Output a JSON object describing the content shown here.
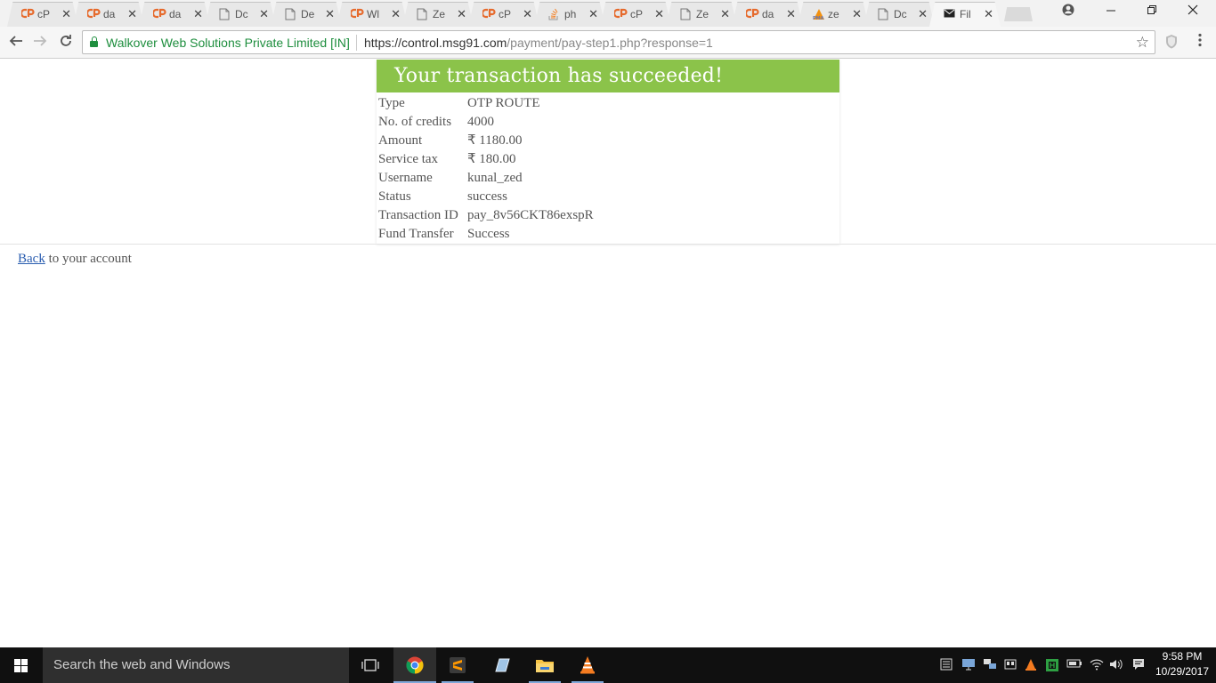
{
  "browser": {
    "tabs": [
      {
        "title": "cP",
        "icon": "cpanel-icon"
      },
      {
        "title": "da",
        "icon": "cpanel-icon"
      },
      {
        "title": "da",
        "icon": "cpanel-icon"
      },
      {
        "title": "Dc",
        "icon": "document-icon"
      },
      {
        "title": "De",
        "icon": "document-icon"
      },
      {
        "title": "Wl",
        "icon": "cpanel-icon"
      },
      {
        "title": "Ze",
        "icon": "document-icon"
      },
      {
        "title": "cP",
        "icon": "cpanel-icon"
      },
      {
        "title": "ph",
        "icon": "stackoverflow-icon"
      },
      {
        "title": "cP",
        "icon": "cpanel-icon"
      },
      {
        "title": "Ze",
        "icon": "document-icon"
      },
      {
        "title": "da",
        "icon": "cpanel-icon"
      },
      {
        "title": "ze",
        "icon": "phpmyadmin-icon"
      },
      {
        "title": "Dc",
        "icon": "document-icon"
      },
      {
        "title": "Fil",
        "icon": "mail-icon"
      }
    ],
    "close_glyph": "✕",
    "cert_name": "Walkover Web Solutions Private Limited [IN]",
    "url_host": "https://control.msg91.com",
    "url_path": "/payment/pay-step1.php?response=1"
  },
  "page": {
    "heading": "Your transaction has succeeded!",
    "rows": [
      {
        "label": "Type",
        "value": "OTP ROUTE"
      },
      {
        "label": "No. of credits",
        "value": "4000"
      },
      {
        "label": "Amount",
        "value": "₹ 1180.00"
      },
      {
        "label": "Service tax",
        "value": "₹ 180.00"
      },
      {
        "label": "Username",
        "value": "kunal_zed"
      },
      {
        "label": "Status",
        "value": "success"
      },
      {
        "label": "Transaction ID",
        "value": "pay_8v56CKT86exspR"
      },
      {
        "label": "Fund Transfer",
        "value": "Success"
      }
    ],
    "back_link": "Back",
    "back_suffix": " to your account"
  },
  "taskbar": {
    "search_placeholder": "Search the web and Windows",
    "time": "9:58 PM",
    "date": "10/29/2017"
  },
  "colors": {
    "header_green": "#8bc34a",
    "secure_green": "#1e8e3e",
    "link_blue": "#2a5db0"
  }
}
